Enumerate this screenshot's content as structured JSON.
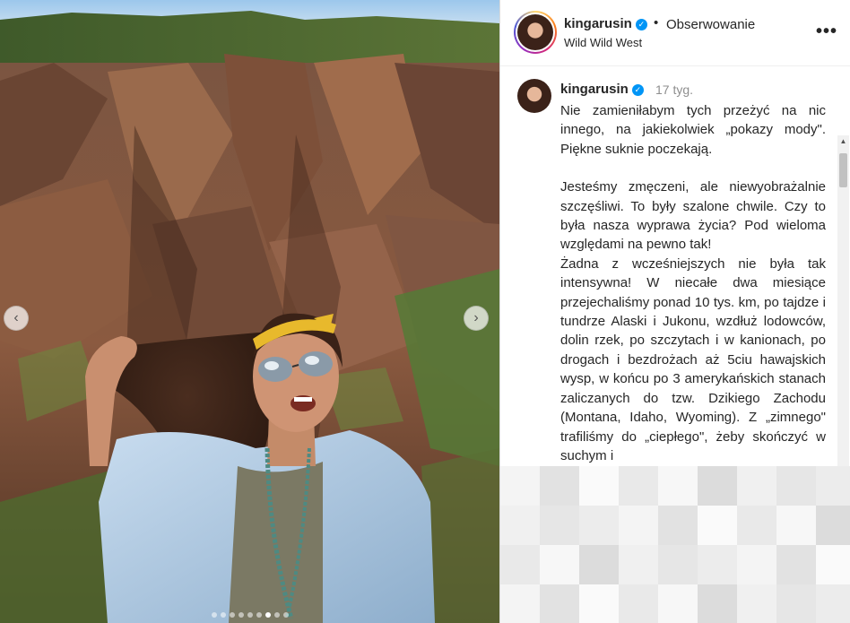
{
  "post": {
    "carousel": {
      "slide_count": 9,
      "active_index": 6,
      "prev_icon": "chevron-left-icon",
      "next_icon": "chevron-right-icon"
    }
  },
  "header": {
    "username": "kingarusin",
    "separator": "•",
    "follow_status": "Obserwowanie",
    "location": "Wild Wild West",
    "more_icon": "more-horizontal-icon",
    "verified_icon": "verified-badge-icon"
  },
  "caption": {
    "username": "kingarusin",
    "time_ago": "17 tyg.",
    "paragraphs": [
      "Nie zamieniłabym tych przeżyć na nic innego, na jakiekolwiek „pokazy mody\". Piękne suknie poczekają.",
      "Jesteśmy zmęczeni, ale niewyobrażalnie szczęśliwi. To były szalone chwile. Czy to była nasza wyprawa życia? Pod wieloma względami na pewno tak!",
      "Żadna z wcześniejszych nie była tak intensywna! W niecałe dwa miesiące przejechaliśmy ponad 10 tys. km, po tajdze i tundrze Alaski i Jukonu, wzdłuż lodowców, dolin rzek, po szczytach i w kanionach, po drogach i bezdrożach aż 5ciu hawajskich wysp, w końcu po 3 amerykańskich stanach zaliczanych do tzw. Dzikiego Zachodu (Montana, Idaho, Wyoming). Z „zimnego\" trafiliśmy do „ciepłego\", żeby skończyć w suchym i"
    ]
  },
  "colors": {
    "verified_blue": "#0095f6",
    "secondary_text": "#8e8e8e",
    "primary_text": "#262626"
  }
}
